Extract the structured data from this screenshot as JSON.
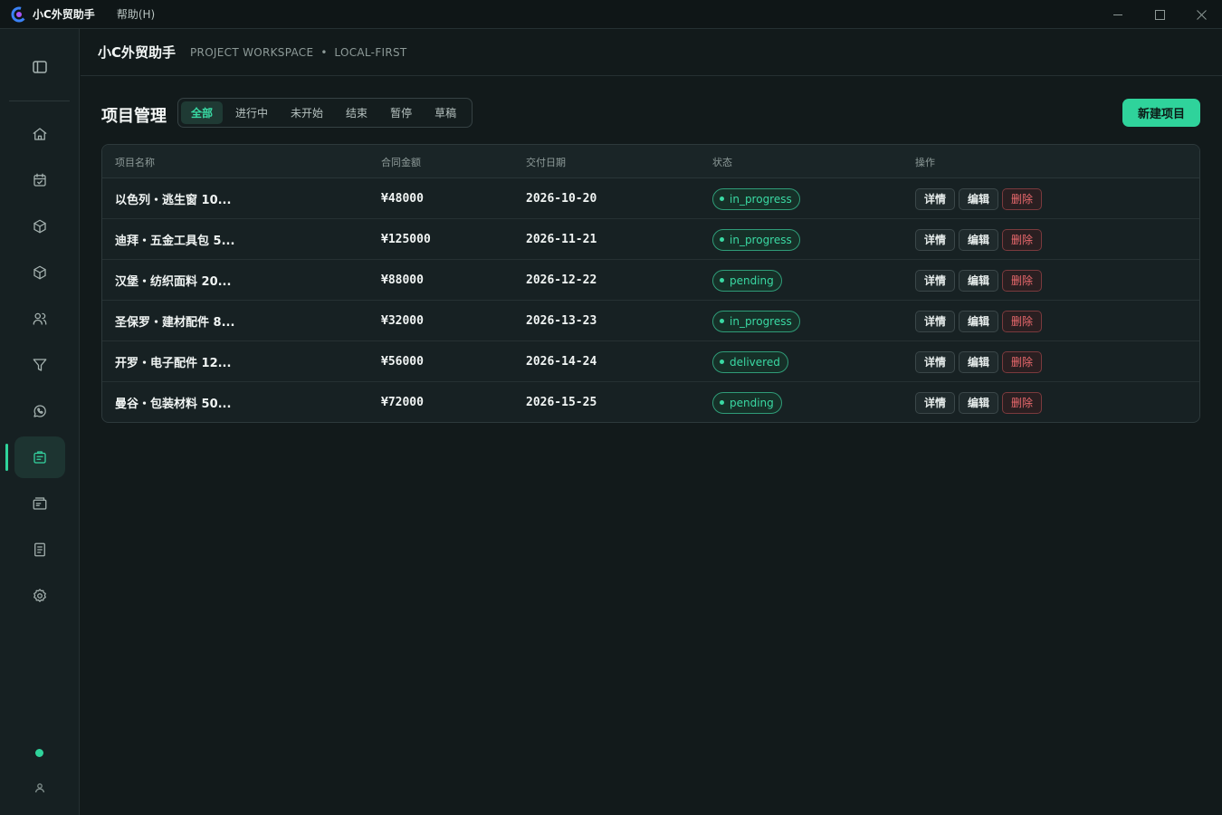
{
  "titlebar": {
    "app_name": "小C外贸助手",
    "menu_help": "帮助(H)"
  },
  "header": {
    "title": "小C外贸助手",
    "subtitle_left": "PROJECT WORKSPACE",
    "separator": "•",
    "subtitle_right": "LOCAL-FIRST"
  },
  "sidebar": {
    "items": [
      {
        "icon": "home-icon"
      },
      {
        "icon": "calendar-icon"
      },
      {
        "icon": "box-icon"
      },
      {
        "icon": "package-icon"
      },
      {
        "icon": "users-icon"
      },
      {
        "icon": "funnel-icon"
      },
      {
        "icon": "whatsapp-icon"
      },
      {
        "icon": "projects-icon",
        "active": true
      },
      {
        "icon": "folder-icon"
      },
      {
        "icon": "document-icon"
      },
      {
        "icon": "settings-icon"
      }
    ],
    "accent_color": "#2fd39b"
  },
  "main": {
    "page_title": "项目管理",
    "tabs": [
      {
        "label": "全部",
        "active": true
      },
      {
        "label": "进行中"
      },
      {
        "label": "未开始"
      },
      {
        "label": "结束"
      },
      {
        "label": "暂停"
      },
      {
        "label": "草稿"
      }
    ],
    "new_button": "新建项目"
  },
  "table": {
    "headers": {
      "name": "项目名称",
      "amount": "合同金额",
      "date": "交付日期",
      "status": "状态",
      "ops": "操作"
    },
    "actions": {
      "detail": "详情",
      "edit": "编辑",
      "delete": "删除"
    },
    "rows": [
      {
        "name": "以色列・逃生窗 10...",
        "amount": "¥48000",
        "date": "2026-10-20",
        "status": "in_progress"
      },
      {
        "name": "迪拜・五金工具包 5...",
        "amount": "¥125000",
        "date": "2026-11-21",
        "status": "in_progress"
      },
      {
        "name": "汉堡・纺织面料 20...",
        "amount": "¥88000",
        "date": "2026-12-22",
        "status": "pending"
      },
      {
        "name": "圣保罗・建材配件 8...",
        "amount": "¥32000",
        "date": "2026-13-23",
        "status": "in_progress"
      },
      {
        "name": "开罗・电子配件 12...",
        "amount": "¥56000",
        "date": "2026-14-24",
        "status": "delivered"
      },
      {
        "name": "曼谷・包装材料 50...",
        "amount": "¥72000",
        "date": "2026-15-25",
        "status": "pending"
      }
    ]
  },
  "colors": {
    "accent": "#2fd39b",
    "danger": "#ec6a6e",
    "background": "#121a1b"
  }
}
